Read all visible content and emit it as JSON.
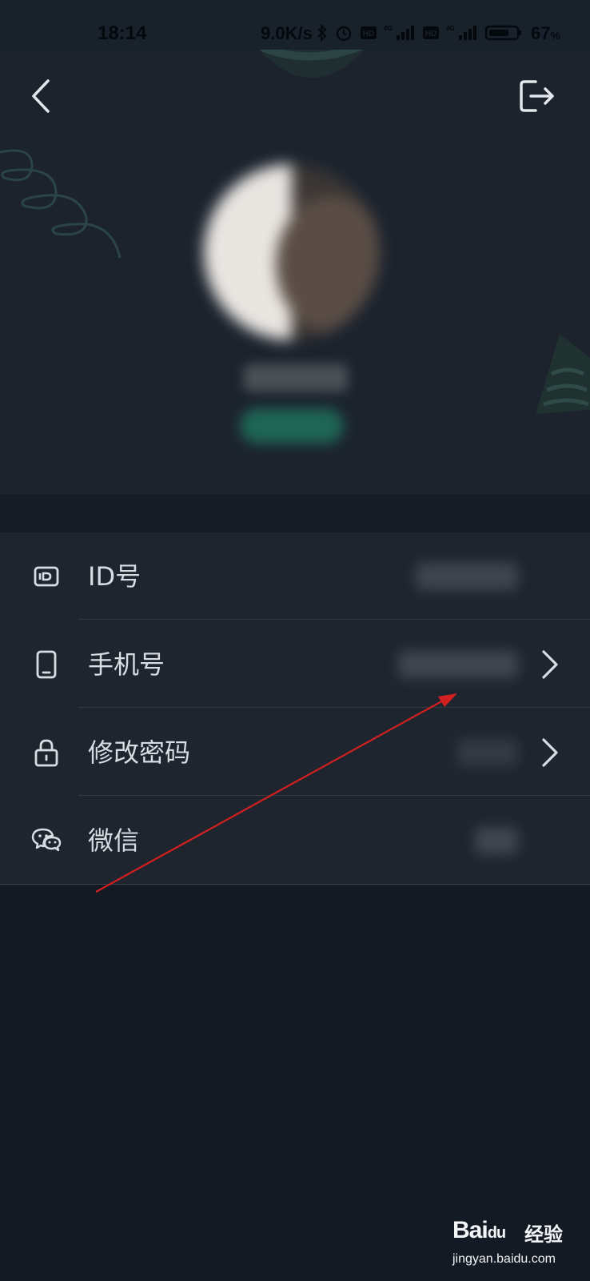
{
  "status_bar": {
    "time": "18:14",
    "net_speed": "9.0K/s",
    "battery_percent": "67",
    "battery_unit": "%",
    "icons": [
      "bluetooth-icon",
      "alarm-icon",
      "hd-icon",
      "signal-4g-icon",
      "hd-icon",
      "signal-4g-icon",
      "battery-icon"
    ]
  },
  "header": {
    "back_icon": "chevron-left-icon",
    "logout_icon": "logout-icon"
  },
  "settings": {
    "items": [
      {
        "label": "ID号",
        "icon": "id-card-icon",
        "has_chevron": false
      },
      {
        "label": "手机号",
        "icon": "phone-icon",
        "has_chevron": true
      },
      {
        "label": "修改密码",
        "icon": "lock-icon",
        "has_chevron": true
      },
      {
        "label": "微信",
        "icon": "wechat-icon",
        "has_chevron": false
      }
    ]
  },
  "annotation": {
    "arrow_color": "#d21f1f"
  },
  "watermark": {
    "brand": "Bai",
    "brand_suffix": "du",
    "brand_cn": "经验",
    "url": "jingyan.baidu.com"
  },
  "colors": {
    "background": "#131a24",
    "header_bg": "#1c232d",
    "list_bg": "#1e252f",
    "text": "#d9dce1",
    "accent_green": "#1f6656"
  }
}
